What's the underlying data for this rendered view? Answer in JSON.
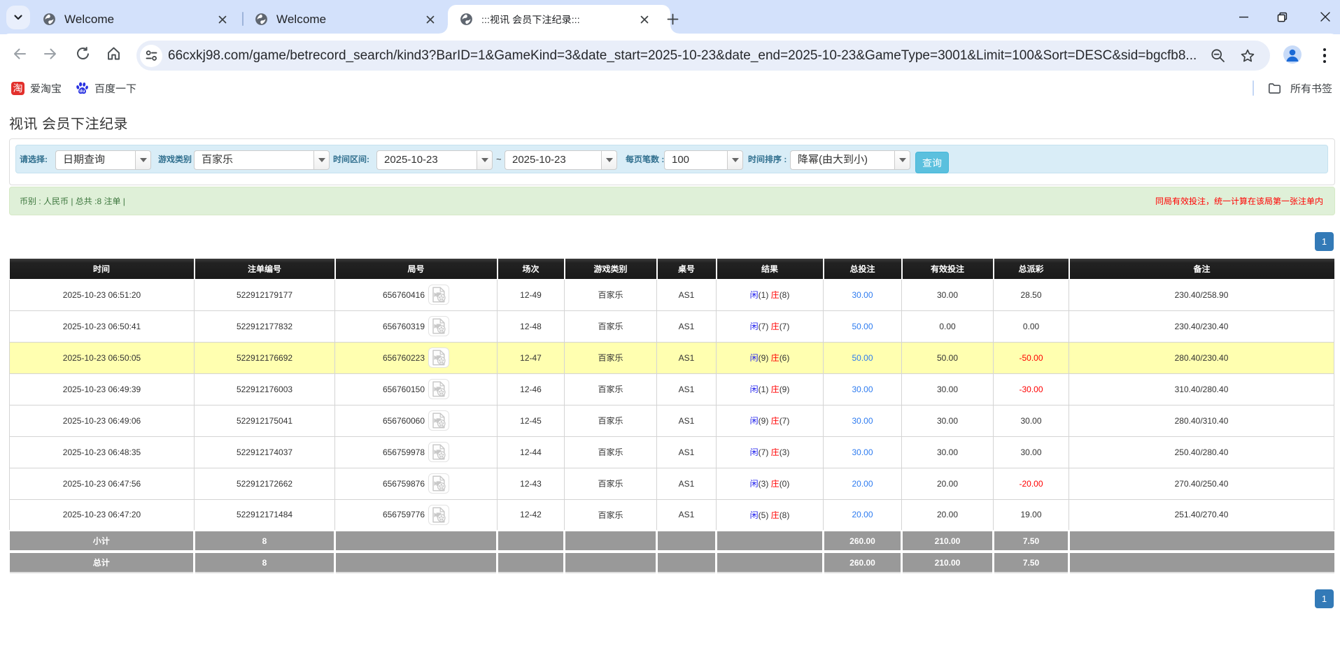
{
  "browser": {
    "tabs": [
      {
        "title": "Welcome"
      },
      {
        "title": "Welcome"
      },
      {
        "title": ":::视讯 会员下注纪录:::"
      }
    ],
    "new_tab_label": "+",
    "url": "66cxkj98.com/game/betrecord_search/kind3?BarID=1&GameKind=3&date_start=2025-10-23&date_end=2025-10-23&GameType=3001&Limit=100&Sort=DESC&sid=bgcfb8...",
    "bookmarks": [
      {
        "label": "爱淘宝",
        "icon": "taobao-icon"
      },
      {
        "label": "百度一下",
        "icon": "baidu-icon"
      }
    ],
    "all_bookmarks_label": "所有书签"
  },
  "page": {
    "title": "视讯 会员下注纪录",
    "filters": {
      "select_label": "请选择:",
      "select_value": "日期查询",
      "game_label": "游戏类别",
      "game_value": "百家乐",
      "range_label": "时间区间:",
      "date_start": "2025-10-23",
      "tilde": "~",
      "date_end": "2025-10-23",
      "page_size_label": "每页笔数 :",
      "page_size_value": "100",
      "sort_label": "时间排序 :",
      "sort_value": "降幂(由大到小)",
      "search_label": "查询"
    },
    "summary": "币别 : 人民币 | 总共 :8 注单 |",
    "notice": "同局有效投注，统一计算在该局第一张注单内",
    "pagination": "1",
    "table": {
      "headers": [
        "时间",
        "注单编号",
        "局号",
        "场次",
        "游戏类别",
        "桌号",
        "结果",
        "总投注",
        "有效投注",
        "总派彩",
        "备注"
      ],
      "rows": [
        {
          "time": "2025-10-23 06:51:20",
          "bet_no": "522912179177",
          "round_no": "656760416",
          "session": "12-49",
          "game": "百家乐",
          "table_no": "AS1",
          "res_p_label": "闲",
          "res_p": "(1)",
          "res_b_label": "庄",
          "res_b": "(8)",
          "total_bet": "30.00",
          "valid_bet": "30.00",
          "payout": "28.50",
          "remark": "230.40/258.90"
        },
        {
          "time": "2025-10-23 06:50:41",
          "bet_no": "522912177832",
          "round_no": "656760319",
          "session": "12-48",
          "game": "百家乐",
          "table_no": "AS1",
          "res_p_label": "闲",
          "res_p": "(7)",
          "res_b_label": "庄",
          "res_b": "(7)",
          "total_bet": "50.00",
          "valid_bet": "0.00",
          "payout": "0.00",
          "remark": "230.40/230.40"
        },
        {
          "time": "2025-10-23 06:50:05",
          "bet_no": "522912176692",
          "round_no": "656760223",
          "session": "12-47",
          "game": "百家乐",
          "table_no": "AS1",
          "res_p_label": "闲",
          "res_p": "(9)",
          "res_b_label": "庄",
          "res_b": "(6)",
          "total_bet": "50.00",
          "valid_bet": "50.00",
          "payout": "-50.00",
          "remark": "280.40/230.40"
        },
        {
          "time": "2025-10-23 06:49:39",
          "bet_no": "522912176003",
          "round_no": "656760150",
          "session": "12-46",
          "game": "百家乐",
          "table_no": "AS1",
          "res_p_label": "闲",
          "res_p": "(1)",
          "res_b_label": "庄",
          "res_b": "(9)",
          "total_bet": "30.00",
          "valid_bet": "30.00",
          "payout": "-30.00",
          "remark": "310.40/280.40"
        },
        {
          "time": "2025-10-23 06:49:06",
          "bet_no": "522912175041",
          "round_no": "656760060",
          "session": "12-45",
          "game": "百家乐",
          "table_no": "AS1",
          "res_p_label": "闲",
          "res_p": "(9)",
          "res_b_label": "庄",
          "res_b": "(7)",
          "total_bet": "30.00",
          "valid_bet": "30.00",
          "payout": "30.00",
          "remark": "280.40/310.40"
        },
        {
          "time": "2025-10-23 06:48:35",
          "bet_no": "522912174037",
          "round_no": "656759978",
          "session": "12-44",
          "game": "百家乐",
          "table_no": "AS1",
          "res_p_label": "闲",
          "res_p": "(7)",
          "res_b_label": "庄",
          "res_b": "(3)",
          "total_bet": "30.00",
          "valid_bet": "30.00",
          "payout": "30.00",
          "remark": "250.40/280.40"
        },
        {
          "time": "2025-10-23 06:47:56",
          "bet_no": "522912172662",
          "round_no": "656759876",
          "session": "12-43",
          "game": "百家乐",
          "table_no": "AS1",
          "res_p_label": "闲",
          "res_p": "(3)",
          "res_b_label": "庄",
          "res_b": "(0)",
          "total_bet": "20.00",
          "valid_bet": "20.00",
          "payout": "-20.00",
          "remark": "270.40/250.40"
        },
        {
          "time": "2025-10-23 06:47:20",
          "bet_no": "522912171484",
          "round_no": "656759776",
          "session": "12-42",
          "game": "百家乐",
          "table_no": "AS1",
          "res_p_label": "闲",
          "res_p": "(5)",
          "res_b_label": "庄",
          "res_b": "(8)",
          "total_bet": "20.00",
          "valid_bet": "20.00",
          "payout": "19.00",
          "remark": "251.40/270.40"
        }
      ],
      "subtotal_label": "小计",
      "total_label": "总计",
      "count": "8",
      "sum_total_bet": "260.00",
      "sum_valid_bet": "210.00",
      "sum_payout": "7.50"
    }
  }
}
